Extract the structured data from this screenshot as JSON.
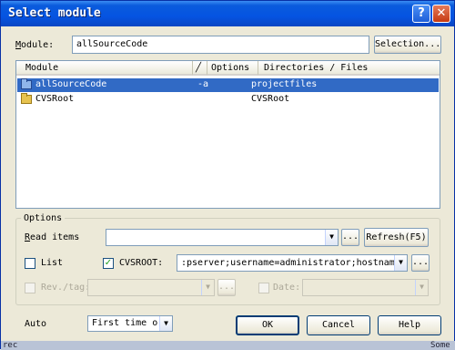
{
  "window": {
    "title": "Select module",
    "help_glyph": "?",
    "close_glyph": "✕"
  },
  "module": {
    "label_first": "M",
    "label_rest": "odule:",
    "value": "allSourceCode",
    "selection_button": "Selection..."
  },
  "list": {
    "columns": [
      "Module",
      "Options",
      "Directories / Files"
    ],
    "rows": [
      {
        "module": "allSourceCode",
        "options": "-a",
        "directories": "projectfiles"
      },
      {
        "module": "CVSRoot",
        "options": "",
        "directories": "CVSRoot"
      }
    ]
  },
  "options": {
    "group_title": "Options",
    "read_items_label_first": "R",
    "read_items_label_rest": "ead items",
    "read_items_value": "",
    "browse_label": "...",
    "refresh_button": "Refresh(F5)",
    "list_checkbox_label": "List",
    "list_checked": false,
    "cvsroot_checkbox_label": "CVSROOT:",
    "cvsroot_checked": true,
    "cvsroot_value": ":pserver;username=administrator;hostname=",
    "rev_tag_label": "Rev./tag:",
    "date_label": "Date:"
  },
  "footer": {
    "auto_label": "Auto",
    "auto_select_value": "First time or",
    "ok_button": "OK",
    "cancel_button": "Cancel",
    "help_button": "Help"
  },
  "background": {
    "left_fragment": "rec",
    "right_fragment": "Some"
  },
  "colors": {
    "titlebar": "#0554e2",
    "selection": "#316ac5",
    "dialog_bg": "#ece9d8"
  }
}
